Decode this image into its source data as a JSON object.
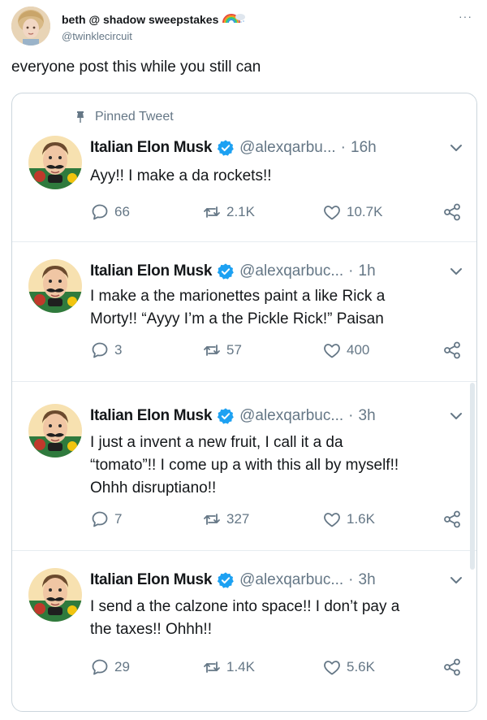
{
  "outer": {
    "display_name": "beth @ shadow sweepstakes",
    "handle": "@twinklecircuit",
    "more_label": "···",
    "text": "everyone post this while you still can"
  },
  "pinned_label": "Pinned Tweet",
  "tweets": [
    {
      "name": "Italian Elon Musk",
      "handle": "@alexqarbu...",
      "dot": "·",
      "time": "16h",
      "lines": [
        "Ayy!! I make a da rockets!!"
      ],
      "replies": "66",
      "retweets": "2.1K",
      "likes": "10.7K"
    },
    {
      "name": "Italian Elon Musk",
      "handle": "@alexqarbuc...",
      "dot": "·",
      "time": "1h",
      "lines": [
        "I make a the marionettes paint a like Rick a",
        "Morty!! “Ayyy I’m a the Pickle Rick!” Paisan"
      ],
      "replies": "3",
      "retweets": "57",
      "likes": "400"
    },
    {
      "name": "Italian Elon Musk",
      "handle": "@alexqarbuc...",
      "dot": "·",
      "time": "3h",
      "lines": [
        "I just a invent a new fruit, I call it a da",
        "“tomato”!! I come up a with this all by myself!!",
        "Ohhh disruptiano!!"
      ],
      "replies": "7",
      "retweets": "327",
      "likes": "1.6K"
    },
    {
      "name": "Italian Elon Musk",
      "handle": "@alexqarbuc...",
      "dot": "·",
      "time": "3h",
      "lines": [
        "I send a the calzone into space!! I don’t pay a",
        "the taxes!! Ohhh!!"
      ],
      "replies": "29",
      "retweets": "1.4K",
      "likes": "5.6K"
    }
  ],
  "colors": {
    "verified": "#1da1f2",
    "secondary_text": "#657786",
    "border": "#e6ecf0"
  },
  "icons": [
    "rainbow-cloud-icon",
    "pin-icon",
    "verified-icon",
    "chevron-down-icon",
    "reply-icon",
    "retweet-icon",
    "like-icon",
    "share-icon"
  ]
}
